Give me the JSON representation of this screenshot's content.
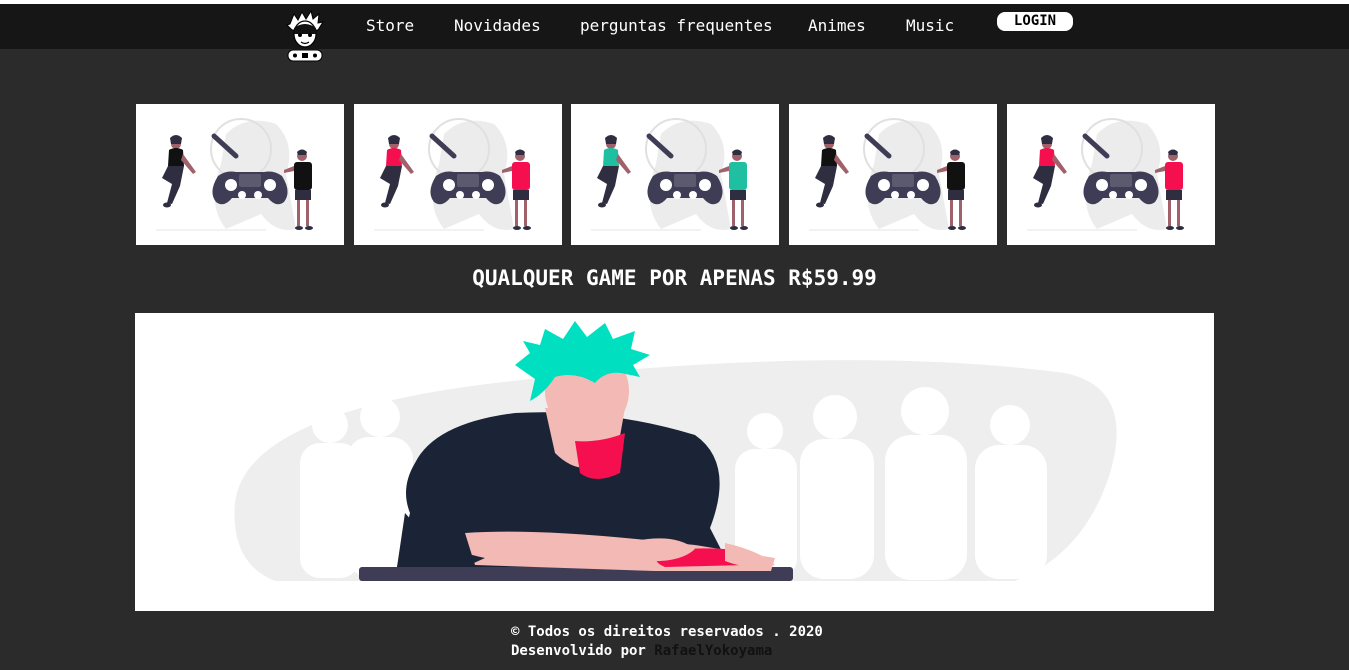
{
  "nav": {
    "links": [
      {
        "label": "Store"
      },
      {
        "label": "Novidades"
      },
      {
        "label": "perguntas frequentes"
      },
      {
        "label": "Animes"
      },
      {
        "label": "Music"
      }
    ],
    "login_label": "LOGIN"
  },
  "cards": {
    "accent_colors": [
      "#111111",
      "#f50f4f",
      "#1fbfa2",
      "#111111",
      "#f50f4f"
    ]
  },
  "promo": {
    "headline": "QUALQUER GAME POR APENAS R$59.99"
  },
  "banner": {
    "hair_color": "#00e0c0",
    "shirt_color": "#1b2436"
  },
  "footer": {
    "copyright": "© Todos os direitos reservados . 2020",
    "dev_prefix": "Desenvolvido por ",
    "dev_name": "RafaelYokoyama"
  }
}
